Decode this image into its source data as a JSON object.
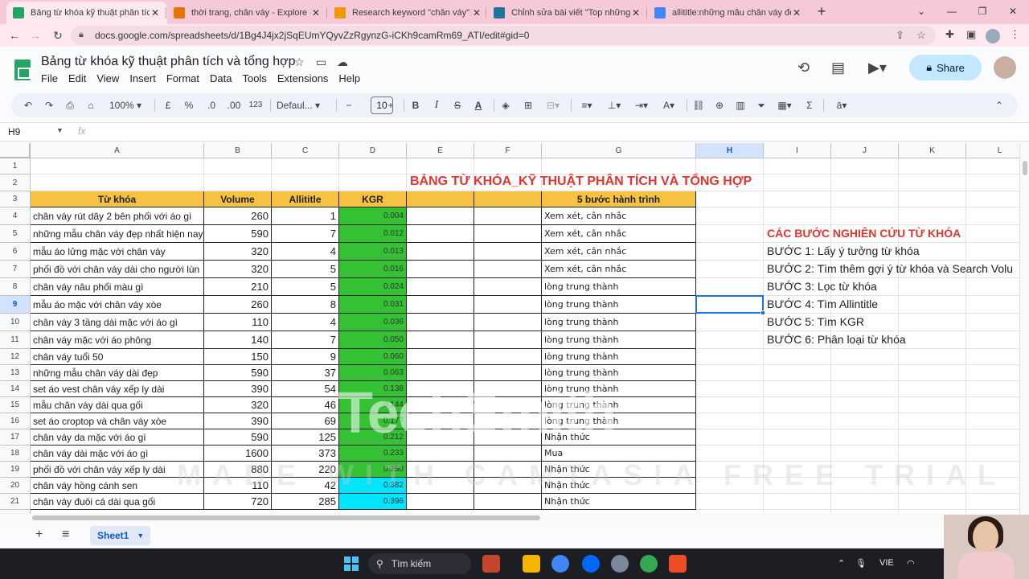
{
  "browser": {
    "tabs": [
      {
        "label": "Bảng từ khóa kỹ thuật phân tích",
        "icon": "sheets-icon",
        "color": "#23a566",
        "active": true
      },
      {
        "label": "thời trang, chân váy - Explore - G",
        "icon": "trends-icon",
        "color": "#e37400",
        "active": false
      },
      {
        "label": "Research keyword \"chân váy\"",
        "icon": "clock-icon",
        "color": "#f29900",
        "active": false
      },
      {
        "label": "Chỉnh sửa bài viết \"Top những m",
        "icon": "wordpress-icon",
        "color": "#21759b",
        "active": false
      },
      {
        "label": "allititle:những mẫu chân váy đẹp",
        "icon": "google-icon",
        "color": "#4285f4",
        "active": false
      }
    ],
    "url": "docs.google.com/spreadsheets/d/1Bg4J4jx2jSqEUmYQyvZzRgynzG-iCKh9camRm69_ATI/edit#gid=0"
  },
  "doc": {
    "title": "Bảng từ khóa kỹ thuật phân tích và tổng hợp",
    "menus": [
      "File",
      "Edit",
      "View",
      "Insert",
      "Format",
      "Data",
      "Tools",
      "Extensions",
      "Help"
    ],
    "share_label": "Share"
  },
  "toolbar": {
    "zoom": "100%",
    "currency": "£",
    "percent": "%",
    "dec_decrease": ".0",
    "dec_increase": ".00",
    "number_format": "123",
    "font": "Defaul...",
    "font_size": "10",
    "bold": "B",
    "italic": "I",
    "strike": "S",
    "text_color": "A"
  },
  "formula": {
    "cell_ref": "H9",
    "fx": "fx"
  },
  "grid": {
    "columns": [
      "A",
      "B",
      "C",
      "D",
      "E",
      "F",
      "G",
      "H",
      "I",
      "J",
      "K",
      "L"
    ],
    "selected_column": "H",
    "selected_row": "9",
    "sheet_title": "BẢNG TỪ KHÓA_KỸ THUẬT PHÂN TÍCH VÀ TỔNG HỢP",
    "headers": {
      "keyword": "Từ khóa",
      "volume": "Volume",
      "allintitle": "Allititle",
      "kgr": "KGR",
      "journey": "5 bước hành trình"
    },
    "rows": [
      {
        "row": "4",
        "keyword": "chân váy rút dây 2 bên phối với áo gì",
        "volume": "260",
        "allintitle": "1",
        "kgr": "0.004",
        "kgr_color": "#34c133",
        "journey": "Xem xét, cân nhắc"
      },
      {
        "row": "5",
        "keyword": "những mẫu chân váy đẹp nhất hiện nay",
        "volume": "590",
        "allintitle": "7",
        "kgr": "0.012",
        "kgr_color": "#34c133",
        "journey": "Xem xét, cân nhắc"
      },
      {
        "row": "6",
        "keyword": "mẫu áo lửng mặc với chân váy",
        "volume": "320",
        "allintitle": "4",
        "kgr": "0.013",
        "kgr_color": "#34c133",
        "journey": "Xem xét, cân nhắc"
      },
      {
        "row": "7",
        "keyword": "phối đồ với chân váy dài cho người lùn",
        "volume": "320",
        "allintitle": "5",
        "kgr": "0.016",
        "kgr_color": "#34c133",
        "journey": "Xem xét, cân nhắc"
      },
      {
        "row": "8",
        "keyword": "chân váy nâu phối màu gì",
        "volume": "210",
        "allintitle": "5",
        "kgr": "0.024",
        "kgr_color": "#34c133",
        "journey": "lòng trung thành"
      },
      {
        "row": "9",
        "keyword": "mẫu áo mặc với chân váy xòe",
        "volume": "260",
        "allintitle": "8",
        "kgr": "0.031",
        "kgr_color": "#34c133",
        "journey": "lòng trung thành"
      },
      {
        "row": "10",
        "keyword": "chân váy 3 tầng dài mặc với áo gì",
        "volume": "110",
        "allintitle": "4",
        "kgr": "0.036",
        "kgr_color": "#34c133",
        "journey": "lòng trung thành"
      },
      {
        "row": "11",
        "keyword": "chân váy mặc với áo phông",
        "volume": "140",
        "allintitle": "7",
        "kgr": "0.050",
        "kgr_color": "#34c133",
        "journey": "lòng trung thành"
      },
      {
        "row": "12",
        "keyword": "chân váy tuổi 50",
        "volume": "150",
        "allintitle": "9",
        "kgr": "0.060",
        "kgr_color": "#34c133",
        "journey": "lòng trung thành"
      },
      {
        "row": "13",
        "keyword": "những mẫu chân váy dài đẹp",
        "volume": "590",
        "allintitle": "37",
        "kgr": "0.063",
        "kgr_color": "#34c133",
        "journey": "lòng trung thành"
      },
      {
        "row": "14",
        "keyword": "set áo vest chân váy xếp ly dài",
        "volume": "390",
        "allintitle": "54",
        "kgr": "0.138",
        "kgr_color": "#34c133",
        "journey": "lòng trung thành"
      },
      {
        "row": "15",
        "keyword": "mẫu chân váy dài qua gối",
        "volume": "320",
        "allintitle": "46",
        "kgr": "0.144",
        "kgr_color": "#34c133",
        "journey": "lòng trung thành"
      },
      {
        "row": "16",
        "keyword": "set áo croptop và chân váy xòe",
        "volume": "390",
        "allintitle": "69",
        "kgr": "0.177",
        "kgr_color": "#34c133",
        "journey": "lòng trung thành"
      },
      {
        "row": "17",
        "keyword": "chân váy da mặc với áo gì",
        "volume": "590",
        "allintitle": "125",
        "kgr": "0.212",
        "kgr_color": "#34c133",
        "journey": "Nhận thức"
      },
      {
        "row": "18",
        "keyword": "chân váy dài mặc với áo gì",
        "volume": "1600",
        "allintitle": "373",
        "kgr": "0.233",
        "kgr_color": "#34c133",
        "journey": "Mua"
      },
      {
        "row": "19",
        "keyword": "phối đồ với chân váy xếp ly dài",
        "volume": "880",
        "allintitle": "220",
        "kgr": "0.250",
        "kgr_color": "#34c133",
        "journey": "Nhận thức"
      },
      {
        "row": "20",
        "keyword": "chân váy hồng cánh sen",
        "volume": "110",
        "allintitle": "42",
        "kgr": "0.382",
        "kgr_color": "#00e5ff",
        "journey": "Nhận thức"
      },
      {
        "row": "21",
        "keyword": "chân váy đuôi cá dài qua gối",
        "volume": "720",
        "allintitle": "285",
        "kgr": "0.396",
        "kgr_color": "#00e5ff",
        "journey": "Nhận thức"
      }
    ],
    "notes": {
      "heading": "CÁC BƯỚC NGHIÊN CỨU TỪ KHÓA",
      "steps": [
        "BƯỚC 1: Lấy ý tưởng từ khóa",
        "BƯỚC 2: Tìm thêm gợi ý từ khóa và Search Volu",
        "BƯỚC 3: Lọc từ khóa",
        "BƯỚC 4: Tìm Allintitle",
        "BƯỚC 5: Tìm KGR",
        "BƯỚC 6: Phân loại từ khóa"
      ]
    }
  },
  "watermark": {
    "line1": "TechSmith",
    "line2": "MADE WITH CAMTASIA FREE TRIAL"
  },
  "sheets": {
    "active": "Sheet1"
  },
  "taskbar": {
    "search_label": "Tìm kiếm",
    "lang": "VIE"
  },
  "colors": {
    "header_fill": "#f7c242",
    "title_red": "#e3342f",
    "kgr_green": "#34c133",
    "kgr_cyan": "#00e5ff",
    "accent": "#1a73e8"
  }
}
